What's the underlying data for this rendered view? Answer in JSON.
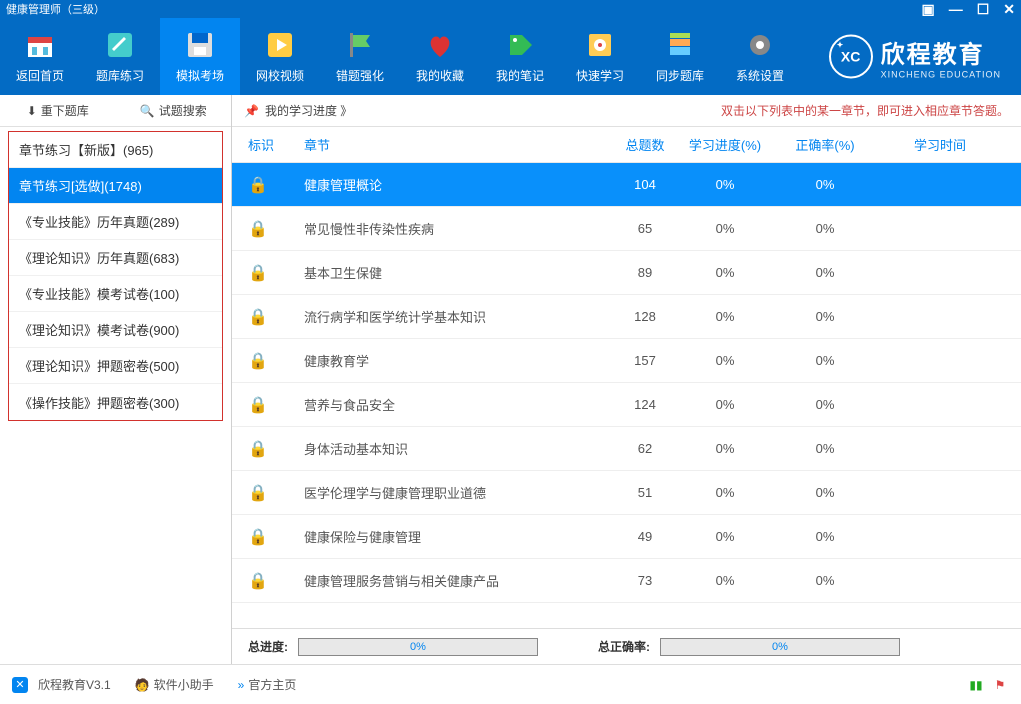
{
  "window_title": "健康管理师（三级）",
  "toolbar": [
    {
      "icon": "home",
      "label": "返回首页"
    },
    {
      "icon": "pencil",
      "label": "题库练习"
    },
    {
      "icon": "save",
      "label": "模拟考场",
      "active": true
    },
    {
      "icon": "play",
      "label": "网校视频"
    },
    {
      "icon": "flag",
      "label": "错题强化"
    },
    {
      "icon": "heart",
      "label": "我的收藏"
    },
    {
      "icon": "tag",
      "label": "我的笔记"
    },
    {
      "icon": "safe",
      "label": "快速学习"
    },
    {
      "icon": "stack",
      "label": "同步题库"
    },
    {
      "icon": "gear",
      "label": "系统设置"
    }
  ],
  "brand": {
    "cn": "欣程教育",
    "en": "XINCHENG EDUCATION",
    "badge": "XC"
  },
  "sidebar_buttons": {
    "download": "重下题库",
    "search": "试题搜索"
  },
  "sidebar_items": [
    "章节练习【新版】(965)",
    "章节练习[选做](1748)",
    "《专业技能》历年真题(289)",
    "《理论知识》历年真题(683)",
    "《专业技能》模考试卷(100)",
    "《理论知识》模考试卷(900)",
    "《理论知识》押题密卷(500)",
    "《操作技能》押题密卷(300)"
  ],
  "sidebar_selected_index": 1,
  "progress_label": "我的学习进度 》",
  "hint": "双击以下列表中的某一章节，即可进入相应章节答题。",
  "table_headers": {
    "mark": "标识",
    "chapter": "章节",
    "total": "总题数",
    "progress": "学习进度(%)",
    "accuracy": "正确率(%)",
    "time": "学习时间"
  },
  "chapters": [
    {
      "name": "健康管理概论",
      "total": 104,
      "progress": "0%",
      "accuracy": "0%",
      "featured": true
    },
    {
      "name": "常见慢性非传染性疾病",
      "total": 65,
      "progress": "0%",
      "accuracy": "0%"
    },
    {
      "name": "基本卫生保健",
      "total": 89,
      "progress": "0%",
      "accuracy": "0%"
    },
    {
      "name": "流行病学和医学统计学基本知识",
      "total": 128,
      "progress": "0%",
      "accuracy": "0%"
    },
    {
      "name": "健康教育学",
      "total": 157,
      "progress": "0%",
      "accuracy": "0%"
    },
    {
      "name": "营养与食品安全",
      "total": 124,
      "progress": "0%",
      "accuracy": "0%"
    },
    {
      "name": "身体活动基本知识",
      "total": 62,
      "progress": "0%",
      "accuracy": "0%"
    },
    {
      "name": "医学伦理学与健康管理职业道德",
      "total": 51,
      "progress": "0%",
      "accuracy": "0%"
    },
    {
      "name": "健康保险与健康管理",
      "total": 49,
      "progress": "0%",
      "accuracy": "0%"
    },
    {
      "name": "健康管理服务营销与相关健康产品",
      "total": 73,
      "progress": "0%",
      "accuracy": "0%"
    }
  ],
  "summary": {
    "total_progress_label": "总进度:",
    "total_progress_value": "0%",
    "total_accuracy_label": "总正确率:",
    "total_accuracy_value": "0%"
  },
  "statusbar": {
    "app": "欣程教育V3.1",
    "helper": "软件小助手",
    "official": "官方主页"
  }
}
